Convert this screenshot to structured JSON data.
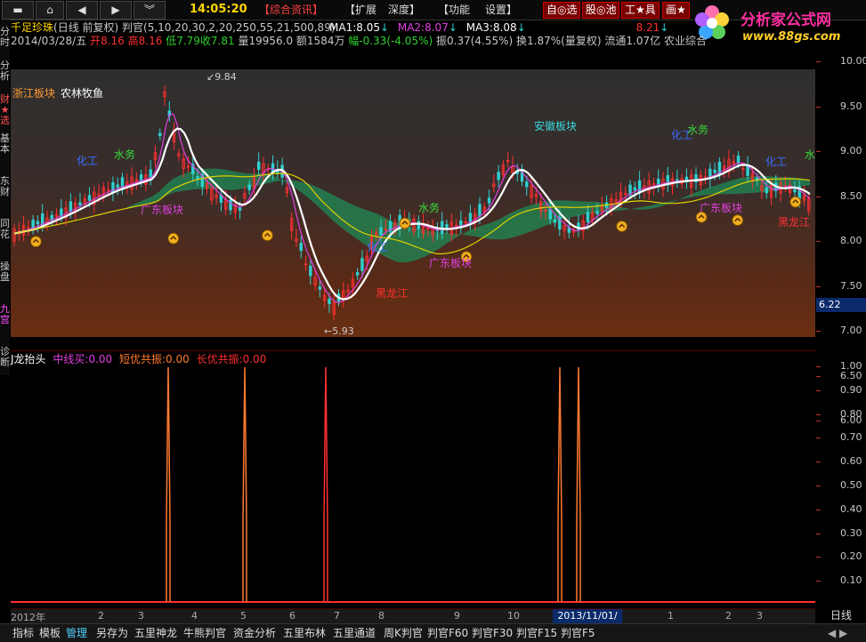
{
  "toolbar": {
    "home_icon": "home-icon",
    "clock": "14:05:20",
    "news": "【综合资讯】",
    "menus": [
      "【扩展",
      "深度】",
      "【功能",
      "设置】"
    ],
    "tags": [
      "自◎选",
      "股◎池",
      "工★具",
      "画★"
    ]
  },
  "logo": {
    "title": "分析家公式网",
    "url": "www.88gs.com"
  },
  "left_tabs": [
    "分时",
    "分析",
    "财★选",
    "基本",
    "东财",
    "同花",
    "操盘",
    "九宫",
    "诊断"
  ],
  "info": {
    "stock": "千足珍珠",
    "desc": "(日线 前复权)",
    "formula": "判官(5,10,20,30,2,20,250,55,21,500,89)",
    "ma1_label": "MA1:",
    "ma1": "8.05",
    "ma2_label": "MA2:",
    "ma2": "8.07",
    "ma3_label": "MA3:",
    "ma3": "8.08",
    "extra": "8.21",
    "date": "2014/03/28/五",
    "open_label": "开",
    "open": "8.16",
    "high_label": "高",
    "high": "8.16",
    "low_label": "低",
    "low": "7.79",
    "close_label": "收",
    "close": "7.81",
    "volume": "量19956.0",
    "amount": "额1584万",
    "change": "幅-0.33(-4.05%)",
    "amp": "振0.37(4.55%)",
    "turnover": "换1.87%(量复权)",
    "float": "流通1.07亿",
    "sector": "农业综合"
  },
  "price_panel": {
    "board_label": "浙江板块",
    "board_label2": "农林牧鱼",
    "high_mark": "9.84",
    "low_mark": "5.93",
    "current_price": "6.22",
    "y_ticks": [
      "10.00",
      "9.50",
      "9.00",
      "8.50",
      "8.00",
      "7.50",
      "7.00",
      "6.50",
      "6.00"
    ],
    "annotations": [
      {
        "text": "化工",
        "color": "#3a6cff"
      },
      {
        "text": "水务",
        "color": "#39d839"
      },
      {
        "text": "广东板块",
        "color": "#e040e0"
      },
      {
        "text": "水务",
        "color": "#39d839"
      },
      {
        "text": "化工",
        "color": "#3a6cff"
      },
      {
        "text": "广东板块",
        "color": "#e040e0"
      },
      {
        "text": "黑龙江",
        "color": "#ff3030"
      },
      {
        "text": "安徽板块",
        "color": "#39d8d8"
      },
      {
        "text": "化工",
        "color": "#3a6cff"
      },
      {
        "text": "水务",
        "color": "#39d839"
      },
      {
        "text": "广东板块",
        "color": "#e040e0"
      },
      {
        "text": "化工",
        "color": "#3a6cff"
      },
      {
        "text": "水",
        "color": "#39d839"
      },
      {
        "text": "黑龙江",
        "color": "#ff3030"
      }
    ]
  },
  "indicator": {
    "name": "J龙抬头",
    "mid_buy_label": "中线买:",
    "mid_buy": "0.00",
    "short_label": "短优共振:",
    "short": "0.00",
    "long_label": "长优共振:",
    "long": "0.00",
    "y_ticks": [
      "1.00",
      "0.90",
      "0.80",
      "0.70",
      "0.60",
      "0.50",
      "0.40",
      "0.30",
      "0.20",
      "0.10"
    ]
  },
  "dates": [
    "2012年",
    "2",
    "3",
    "4",
    "5",
    "6",
    "7",
    "8",
    "9",
    "10",
    "11",
    "12",
    "1",
    "2",
    "3"
  ],
  "date_cursor": "2013/11/01/五",
  "period": "日线",
  "bottom_tabs": [
    "指标",
    "模板",
    "管理",
    "另存为",
    "五里神龙",
    "牛熊判官",
    "资金分析",
    "五里布林",
    "五里通道",
    "周K判官",
    "判官F60",
    "判官F30",
    "判官F15",
    "判官F5"
  ],
  "colors": {
    "up": "#ff3030",
    "down": "#30d0d0",
    "ma_white": "#ffffff",
    "ma_yellow": "#e0d000",
    "ma_magenta": "#e040e0",
    "signal": "#ff7a30"
  }
}
